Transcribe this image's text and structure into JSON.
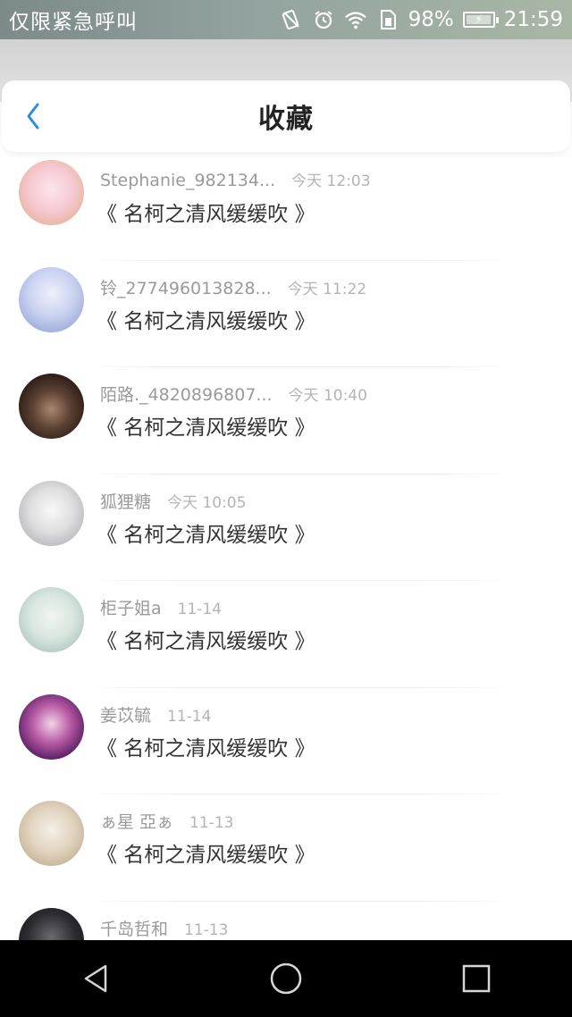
{
  "status_bar": {
    "carrier": "仅限紧急呼叫",
    "battery": "98%",
    "time": "21:59",
    "icons": [
      "no-sim-icon",
      "alarm-icon",
      "wifi-icon",
      "sim-card-icon",
      "battery-charging-icon"
    ]
  },
  "header": {
    "title": "收藏",
    "back_icon": "chevron-left-icon",
    "accent": "#2b8fe0"
  },
  "favorites": [
    {
      "user": "Stephanie_982134...",
      "time": "今天 12:03",
      "work": "《 名柯之清风缓缓吹 》"
    },
    {
      "user": "铃_277496013828...",
      "time": "今天 11:22",
      "work": "《 名柯之清风缓缓吹 》"
    },
    {
      "user": "陌路._4820896807...",
      "time": "今天 10:40",
      "work": "《 名柯之清风缓缓吹 》"
    },
    {
      "user": "狐狸糖",
      "time": "今天 10:05",
      "work": "《 名柯之清风缓缓吹 》"
    },
    {
      "user": "柜子姐a",
      "time": "11-14",
      "work": "《 名柯之清风缓缓吹 》"
    },
    {
      "user": "姜苡毓",
      "time": "11-14",
      "work": "《 名柯之清风缓缓吹 》"
    },
    {
      "user": "ぁ星 亞ぁ",
      "time": "11-13",
      "work": "《 名柯之清风缓缓吹 》"
    },
    {
      "user": "千岛哲和",
      "time": "11-13",
      "work": ""
    }
  ],
  "nav_bar": {
    "icons": [
      "back-triangle-icon",
      "home-circle-icon",
      "recents-square-icon"
    ]
  }
}
